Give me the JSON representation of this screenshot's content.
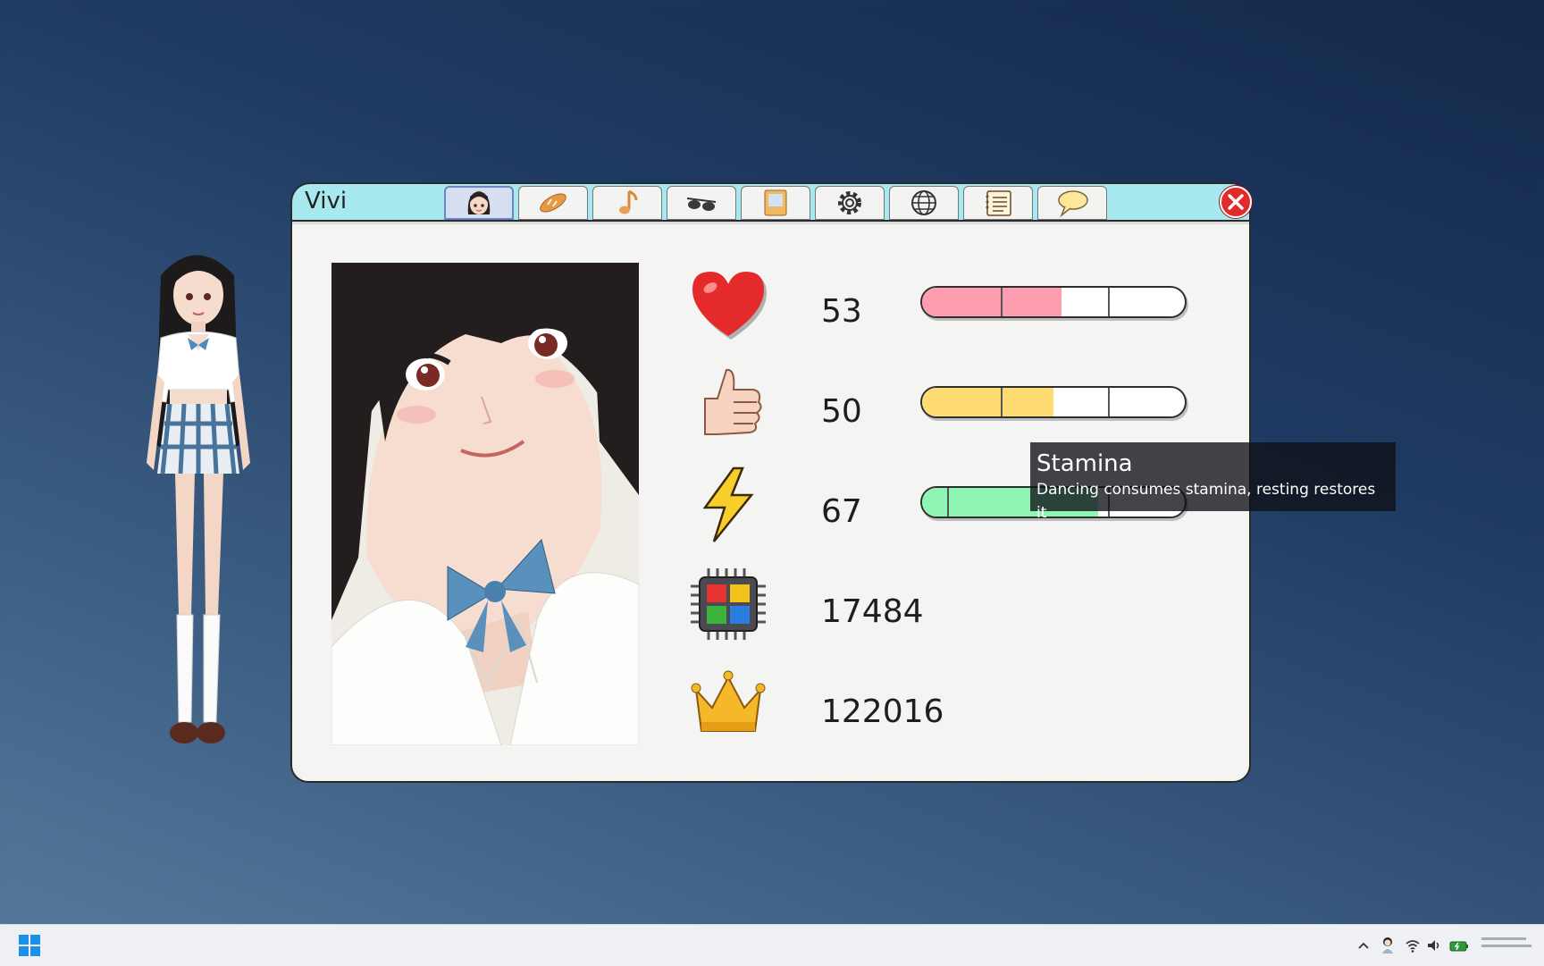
{
  "window": {
    "title": "Vivi"
  },
  "tabs": [
    {
      "name": "tab-character",
      "icon": "girl-face-icon",
      "active": true
    },
    {
      "name": "tab-food",
      "icon": "bread-icon",
      "active": false
    },
    {
      "name": "tab-music",
      "icon": "music-note-icon",
      "active": false
    },
    {
      "name": "tab-accessory",
      "icon": "sunglasses-icon",
      "active": false
    },
    {
      "name": "tab-book",
      "icon": "book-icon",
      "active": false
    },
    {
      "name": "tab-settings",
      "icon": "gear-icon",
      "active": false
    },
    {
      "name": "tab-language",
      "icon": "globe-icon",
      "active": false
    },
    {
      "name": "tab-notes",
      "icon": "notepad-icon",
      "active": false
    },
    {
      "name": "tab-chat",
      "icon": "speech-bubble-icon",
      "active": false
    }
  ],
  "stats": {
    "health": {
      "icon": "heart-icon",
      "value": "53",
      "percent": 53,
      "color": "#ff9db0"
    },
    "likes": {
      "icon": "thumbs-up-icon",
      "value": "50",
      "percent": 50,
      "color": "#ffdc73"
    },
    "stamina": {
      "icon": "lightning-icon",
      "value": "67",
      "percent": 67,
      "color": "#8ef5b5"
    },
    "compute": {
      "icon": "chip-icon",
      "value": "17484"
    },
    "score": {
      "icon": "crown-icon",
      "value": "122016"
    }
  },
  "tooltip": {
    "title": "Stamina",
    "description": "Dancing consumes stamina, resting restores it"
  },
  "colors": {
    "titlebar": "#a8e8ef",
    "close": "#e12b2b",
    "panel": "#f4f4f2"
  }
}
